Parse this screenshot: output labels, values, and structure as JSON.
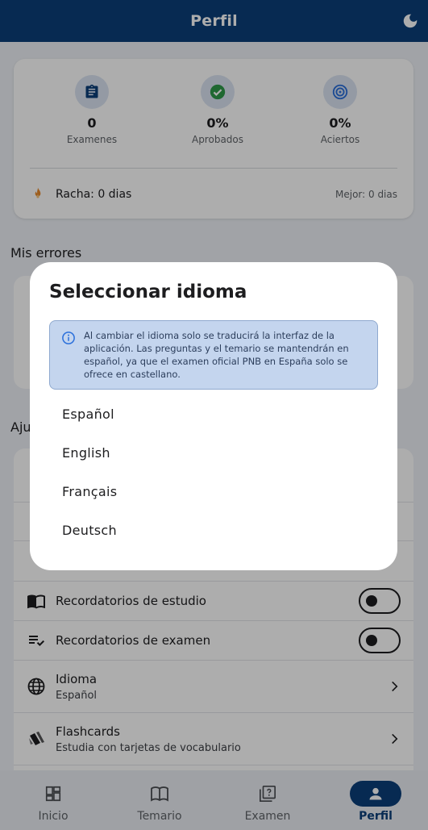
{
  "appbar": {
    "title": "Perfil",
    "theme_icon": "moon-icon"
  },
  "stats": [
    {
      "icon": "clipboard-icon",
      "value": "0",
      "label": "Examenes"
    },
    {
      "icon": "check-circle-icon",
      "value": "0%",
      "label": "Aprobados"
    },
    {
      "icon": "target-icon",
      "value": "0%",
      "label": "Aciertos"
    }
  ],
  "streak": {
    "label": "Racha: 0 dias",
    "best": "Mejor: 0 dias"
  },
  "sections": {
    "errors": "Mis errores",
    "settings_partial": "Aju"
  },
  "settings": [
    {
      "title": "Recordatorios de estudio",
      "icon": "menu-book-icon",
      "toggle": false
    },
    {
      "title": "Recordatorios de examen",
      "icon": "edit-note-icon",
      "toggle": false
    },
    {
      "title": "Idioma",
      "subtitle": "Español",
      "icon": "globe-icon"
    },
    {
      "title": "Flashcards",
      "subtitle": "Estudia con tarjetas de vocabulario",
      "icon": "cards-icon"
    }
  ],
  "bottom_nav": [
    {
      "label": "Inicio",
      "icon": "dashboard-icon",
      "active": false
    },
    {
      "label": "Temario",
      "icon": "book-icon",
      "active": false
    },
    {
      "label": "Examen",
      "icon": "quiz-icon",
      "active": false
    },
    {
      "label": "Perfil",
      "icon": "person-icon",
      "active": true
    }
  ],
  "dialog": {
    "title": "Seleccionar idioma",
    "info": "Al cambiar el idioma solo se traducirá la interfaz de la aplicación. Las preguntas y el temario se mantendrán en español, ya que el examen oficial PNB en España solo se ofrece en castellano.",
    "options": [
      "Español",
      "English",
      "Français",
      "Deutsch"
    ]
  },
  "colors": {
    "primary": "#0b3f7a",
    "background": "#eef1f6",
    "info_bg": "#c4d5ee",
    "success": "#2e9a4a",
    "streak": "#e8892b"
  }
}
